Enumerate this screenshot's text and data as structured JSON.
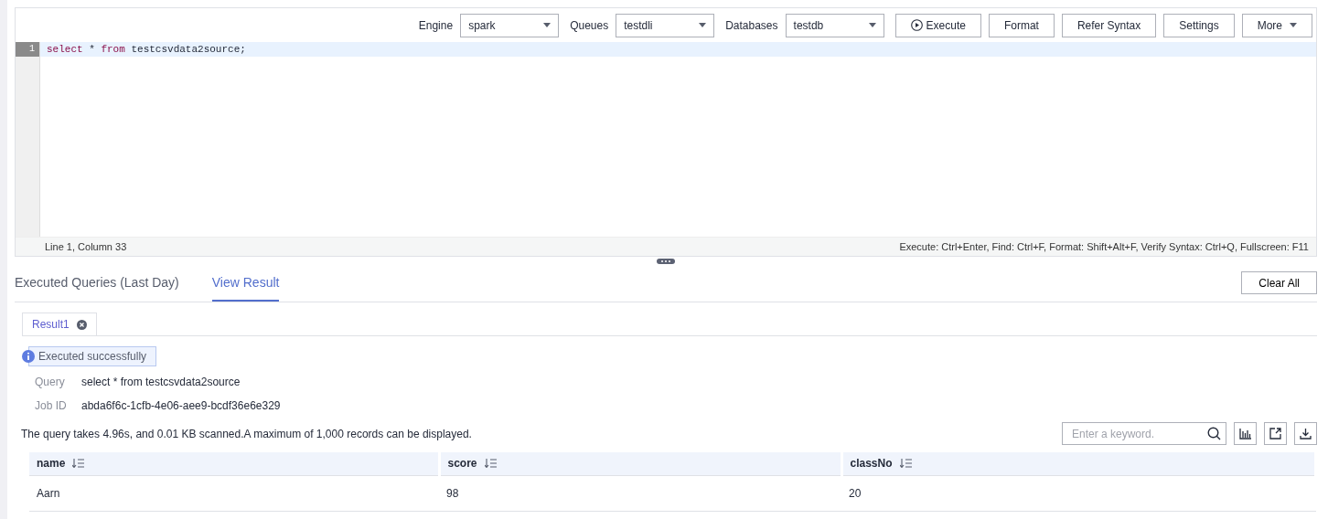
{
  "toolbar": {
    "selects": [
      {
        "label": "Engine",
        "value": "spark"
      },
      {
        "label": "Queues",
        "value": "testdli"
      },
      {
        "label": "Databases",
        "value": "testdb"
      }
    ],
    "buttons": [
      {
        "label": "Execute",
        "kind": "execute"
      },
      {
        "label": "Format",
        "kind": "plain"
      },
      {
        "label": "Refer Syntax",
        "kind": "plain"
      },
      {
        "label": "Settings",
        "kind": "plain"
      },
      {
        "label": "More",
        "kind": "dropdown"
      }
    ]
  },
  "editor": {
    "lines": [
      {
        "number": "1",
        "active": true,
        "tokens": [
          {
            "text": "select",
            "kind": "keyword"
          },
          {
            "text": " * ",
            "kind": "plain"
          },
          {
            "text": "from",
            "kind": "keyword"
          },
          {
            "text": " testcsvdata2source;",
            "kind": "plain"
          }
        ]
      }
    ],
    "status": {
      "position": "Line 1, Column 33",
      "shortcuts": "Execute: Ctrl+Enter, Find: Ctrl+F, Format: Shift+Alt+F, Verify Syntax: Ctrl+Q, Fullscreen: F11"
    }
  },
  "tabs": [
    {
      "label": "Executed Queries (Last Day)",
      "selected": false
    },
    {
      "label": "View Result",
      "selected": true
    }
  ],
  "clear_button": "Clear All",
  "result_tabs": [
    {
      "label": "Result1",
      "selected": true
    }
  ],
  "alert": {
    "text": "Executed successfully"
  },
  "details": [
    {
      "label": "Query",
      "value": "select * from testcsvdata2source"
    },
    {
      "label": "Job ID",
      "value": "abda6f6c-1cfb-4e06-aee9-bcdf36e6e329"
    }
  ],
  "summary": "The query takes 4.96s, and 0.01 KB scanned.A maximum of 1,000 records can be displayed.",
  "search": {
    "placeholder": "Enter a keyword."
  },
  "table": {
    "columns": [
      {
        "label": "name"
      },
      {
        "label": "score"
      },
      {
        "label": "classNo"
      }
    ],
    "rows": [
      [
        "Aarn",
        "98",
        "20"
      ]
    ]
  }
}
